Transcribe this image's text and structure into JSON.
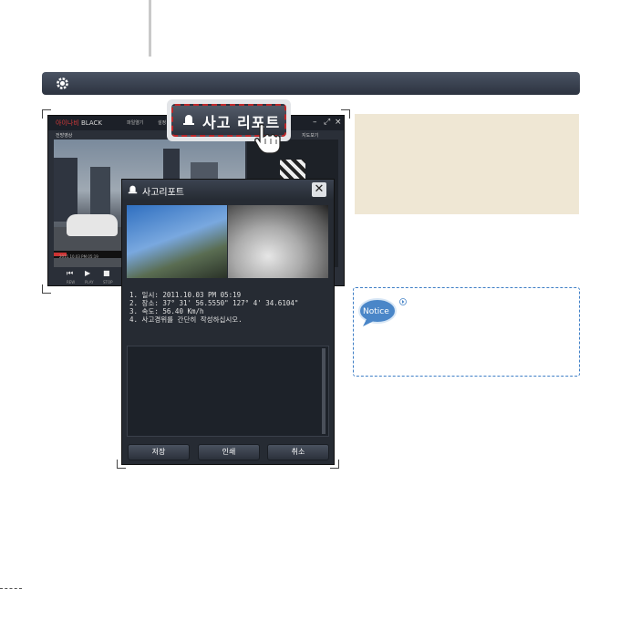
{
  "app": {
    "title_brand": "아이나비",
    "title_rest": " BLACK",
    "menu_1": "파일열기",
    "menu_2": "설정",
    "tab_left": "전방영상",
    "tab_right": "지도보기",
    "timestamp": "2011.10.03 PM 05:19",
    "ctrl_labels": [
      "REW",
      "PLAY",
      "STOP"
    ]
  },
  "callout": {
    "label": "사고 리포트"
  },
  "dialog": {
    "title": "사고리포트",
    "close_glyph": "✕",
    "info_lines": [
      "1. 일시: 2011.10.03 PM 05:19",
      "2. 장소: 37° 31' 56.5550\"  127° 4' 34.6104\"",
      "3. 속도: 56.40 Km/h",
      "4. 사고경위를 간단히 작성하십시오."
    ],
    "buttons": {
      "save": "저장",
      "print": "인쇄",
      "cancel": "취소"
    }
  },
  "notice": {
    "label": "Notice"
  },
  "colors": {
    "accent_red": "#c0282a",
    "notice_blue": "#3f7fc6",
    "panel_beige": "#efe7d4"
  }
}
